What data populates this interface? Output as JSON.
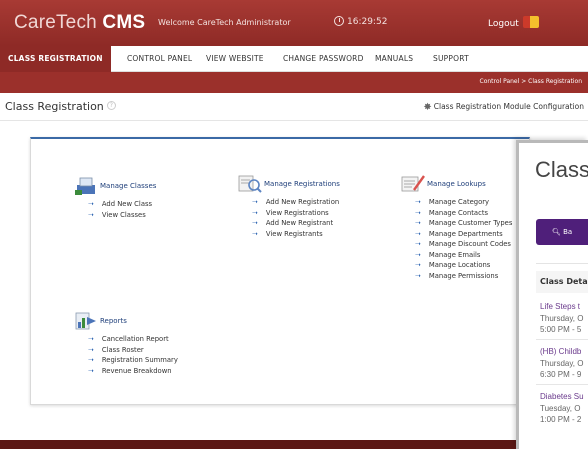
{
  "header": {
    "brand_light": "CareTech",
    "brand_bold": "CMS",
    "welcome": "Welcome CareTech Administrator",
    "time": "16:29:52",
    "logout": "Logout"
  },
  "nav": {
    "items": [
      {
        "label": "CLASS REGISTRATION"
      },
      {
        "label": "CONTROL PANEL"
      },
      {
        "label": "VIEW WEBSITE"
      },
      {
        "label": "CHANGE PASSWORD"
      },
      {
        "label": "MANUALS"
      },
      {
        "label": "SUPPORT"
      }
    ]
  },
  "breadcrumb": "Control Panel  >  Class Registration",
  "page": {
    "title": "Class Registration",
    "config_link": "Class Registration Module Configuration"
  },
  "sections": {
    "classes": {
      "title": "Manage Classes",
      "links": [
        "Add New Class",
        "View Classes"
      ]
    },
    "registrations": {
      "title": "Manage Registrations",
      "links": [
        "Add New Registration",
        "View Registrations",
        "Add New Registrant",
        "View Registrants"
      ]
    },
    "lookups": {
      "title": "Manage Lookups",
      "links": [
        "Manage Category",
        "Manage Contacts",
        "Manage Customer Types",
        "Manage Departments",
        "Manage Discount Codes",
        "Manage Emails",
        "Manage Locations",
        "Manage Permissions"
      ]
    },
    "reports": {
      "title": "Reports",
      "links": [
        "Cancellation Report",
        "Class Roster",
        "Registration Summary",
        "Revenue Breakdown"
      ]
    }
  },
  "overlay": {
    "title": "Class",
    "button": "Ba",
    "details_header": "Class Deta",
    "items": [
      {
        "name": "Life Steps t",
        "day": "Thursday, O",
        "time": "5:00 PM - 5"
      },
      {
        "name": "(HB) Childb",
        "day": "Thursday, O",
        "time": "6:30 PM - 9"
      },
      {
        "name": "Diabetes Su",
        "day": "Tuesday, O",
        "time": "1:00 PM - 2"
      }
    ]
  },
  "colors": {
    "brand_red": "#9b302b",
    "link_blue": "#1f3f7a",
    "accent_purple": "#4f1f7a"
  }
}
